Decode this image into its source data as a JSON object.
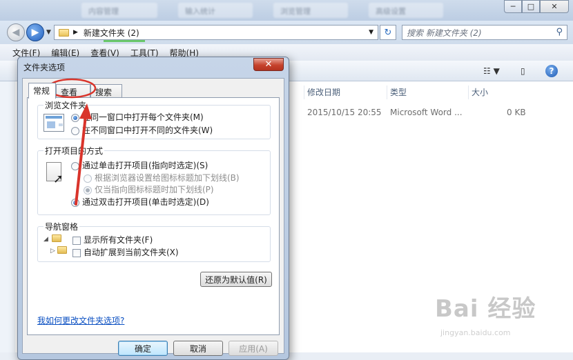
{
  "explorer": {
    "blurred_tabs": [
      "内容管理",
      "输入统计",
      "浏览管理",
      "高级设置"
    ],
    "window_buttons": {
      "minimize": "─",
      "maximize": "□",
      "close": "✕"
    },
    "address": {
      "path": "新建文件夹 (2)",
      "refresh": "↻"
    },
    "search": {
      "placeholder": "搜索 新建文件夹 (2)"
    },
    "menu": [
      "文件(F)",
      "编辑(E)",
      "查看(V)",
      "工具(T)",
      "帮助(H)"
    ],
    "columns": {
      "date": "修改日期",
      "type": "类型",
      "size": "大小"
    },
    "file": {
      "date": "2015/10/15 20:55",
      "type": "Microsoft Word ...",
      "size": "0 KB"
    },
    "help_label": "?"
  },
  "dialog": {
    "title": "文件夹选项",
    "close": "✕",
    "tabs": [
      "常规",
      "查看",
      "搜索"
    ],
    "browse_group": {
      "title": "浏览文件夹",
      "options": [
        "在同一窗口中打开每个文件夹(M)",
        "在不同窗口中打开不同的文件夹(W)"
      ],
      "selected": 0
    },
    "click_group": {
      "title": "打开项目的方式",
      "options": [
        "通过单击打开项目(指向时选定)(S)",
        "根据浏览器设置给图标标题加下划线(B)",
        "仅当指向图标标题时加下划线(P)",
        "通过双击打开项目(单击时选定)(D)"
      ],
      "selected": 3
    },
    "nav_group": {
      "title": "导航窗格",
      "options": [
        "显示所有文件夹(F)",
        "自动扩展到当前文件夹(X)"
      ]
    },
    "restore_button": "还原为默认值(R)",
    "help_link": "我如何更改文件夹选项?",
    "buttons": {
      "ok": "确定",
      "cancel": "取消",
      "apply": "应用(A)"
    }
  },
  "watermark": {
    "logo": "Bai 经验",
    "sub": "jingyan.baidu.com"
  },
  "colors": {
    "annotation": "#d9342b",
    "link": "#0a4fc2",
    "close_button": "#c6432d"
  }
}
